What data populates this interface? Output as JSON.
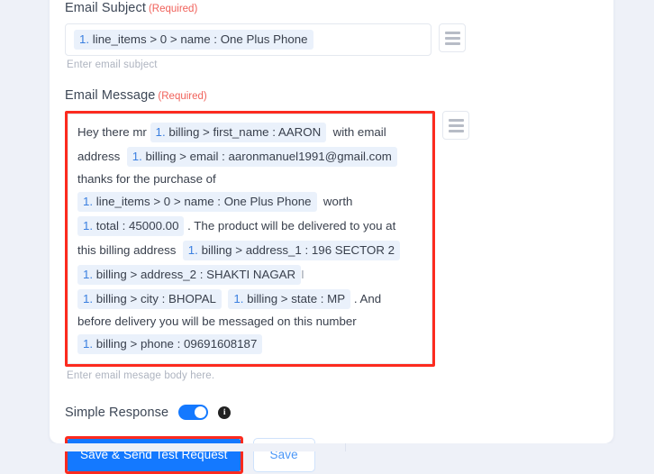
{
  "form": {
    "subject": {
      "label": "Email Subject",
      "required_text": "(Required)",
      "helper": "Enter email subject",
      "menu_icon": "hamburger-menu-icon",
      "tokens": [
        {
          "index": "1.",
          "text": " line_items > 0 > name : One Plus Phone"
        }
      ]
    },
    "message": {
      "label": "Email Message",
      "required_text": "(Required)",
      "helper": "Enter email mesage body here.",
      "menu_icon": "hamburger-menu-icon",
      "lines": [
        [
          {
            "type": "text",
            "value": "Hey there mr "
          },
          {
            "type": "chip",
            "index": "1.",
            "value": " billing > first_name : AARON"
          },
          {
            "type": "text",
            "value": "  with email"
          }
        ],
        [
          {
            "type": "text",
            "value": "address  "
          },
          {
            "type": "chip",
            "index": "1.",
            "value": " billing > email : aaronmanuel1991@gmail.com"
          }
        ],
        [
          {
            "type": "text",
            "value": "thanks for the purchase of"
          }
        ],
        [
          {
            "type": "chip",
            "index": "1.",
            "value": " line_items > 0 > name : One Plus Phone"
          },
          {
            "type": "text",
            "value": "  worth"
          }
        ],
        [
          {
            "type": "chip",
            "index": "1.",
            "value": " total : 45000.00"
          },
          {
            "type": "text",
            "value": " . The product will be delivered to you at"
          }
        ],
        [
          {
            "type": "text",
            "value": "this billing address  "
          },
          {
            "type": "chip",
            "index": "1.",
            "value": " billing > address_1 : 196 SECTOR 2"
          }
        ],
        [
          {
            "type": "chip",
            "index": "1.",
            "value": " billing > address_2 : SHAKTI NAGAR"
          },
          {
            "type": "caret",
            "value": "I"
          }
        ],
        [
          {
            "type": "chip",
            "index": "1.",
            "value": " billing > city : BHOPAL"
          },
          {
            "type": "text",
            "value": "  "
          },
          {
            "type": "chip",
            "index": "1.",
            "value": " billing > state : MP"
          },
          {
            "type": "text",
            "value": " . And"
          }
        ],
        [
          {
            "type": "text",
            "value": "before delivery you will be messaged on this number"
          }
        ],
        [
          {
            "type": "chip",
            "index": "1.",
            "value": " billing > phone : 09691608187"
          }
        ]
      ]
    },
    "simple_response": {
      "label": "Simple Response",
      "toggle_state": "on",
      "info_icon": "info-icon"
    },
    "actions": {
      "primary_label": "Save & Send Test Request",
      "secondary_label": "Save"
    }
  },
  "colors": {
    "accent_blue": "#1479ff",
    "chip_bg": "#eaf1fb",
    "chip_index": "#3a7fe0",
    "required_red": "#f0615a",
    "annotation_red": "#fc2b1f",
    "page_bg": "#eef1f8"
  }
}
